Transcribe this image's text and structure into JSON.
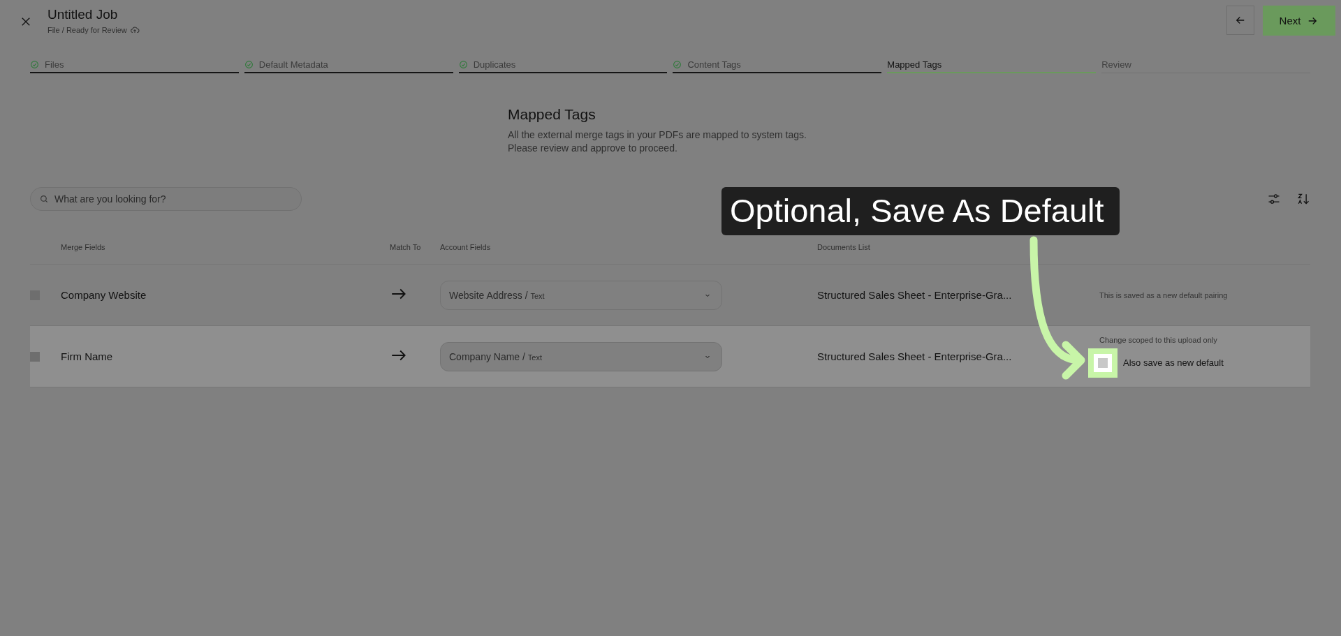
{
  "header": {
    "title": "Untitled Job",
    "breadcrumb": "File / Ready for Review",
    "next_label": "Next"
  },
  "steps": [
    {
      "label": "Files",
      "done": true,
      "selected": false
    },
    {
      "label": "Default Metadata",
      "done": true,
      "selected": false
    },
    {
      "label": "Duplicates",
      "done": true,
      "selected": false
    },
    {
      "label": "Content Tags",
      "done": true,
      "selected": false
    },
    {
      "label": "Mapped Tags",
      "done": false,
      "selected": true
    },
    {
      "label": "Review",
      "done": false,
      "selected": false
    }
  ],
  "intro": {
    "title": "Mapped Tags",
    "lines": [
      "All the external merge tags in your PDFs are mapped to system tags.",
      "Please review and approve to proceed."
    ]
  },
  "search": {
    "placeholder": "What are you looking for?"
  },
  "table": {
    "columns": [
      "Merge Fields",
      "Match To",
      "Account Fields",
      "Documents List"
    ],
    "rows": [
      {
        "checked": false,
        "highlighted": false,
        "merge_field": "Company Website",
        "account_field": "Website Address /",
        "field_type": "Text",
        "document": "Structured Sales Sheet - Enterprise-Gra...",
        "note": "This is saved as a new default pairing"
      },
      {
        "checked": false,
        "highlighted": true,
        "merge_field": "Firm Name",
        "account_field": "Company Name /",
        "field_type": "Text",
        "document": "Structured Sales Sheet - Enterprise-Gra...",
        "note": "Change scoped to this upload only",
        "option": {
          "label": "Also save as new default",
          "checked": false,
          "spotlight": true
        }
      }
    ]
  },
  "tour": {
    "tooltip": "Optional, Save As Default"
  }
}
